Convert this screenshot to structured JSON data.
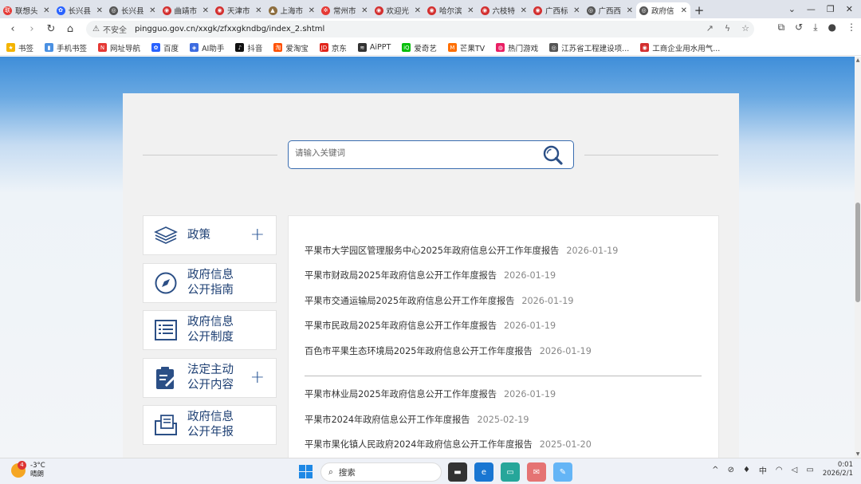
{
  "browser": {
    "tabs": [
      {
        "title": "联想头",
        "color": "#e53935",
        "glyph": "联"
      },
      {
        "title": "长兴县",
        "color": "#2962ff",
        "glyph": "✿"
      },
      {
        "title": "长兴县",
        "color": "#555555",
        "glyph": "◎"
      },
      {
        "title": "曲靖市",
        "color": "#d32f2f",
        "glyph": "◉"
      },
      {
        "title": "天津市",
        "color": "#d32f2f",
        "glyph": "◉"
      },
      {
        "title": "上海市",
        "color": "#8d6e3f",
        "glyph": "▲"
      },
      {
        "title": "常州市",
        "color": "#e53935",
        "glyph": "✲"
      },
      {
        "title": "欢迎光",
        "color": "#d32f2f",
        "glyph": "◉"
      },
      {
        "title": "哈尔滨",
        "color": "#d32f2f",
        "glyph": "◉"
      },
      {
        "title": "六枝特",
        "color": "#d32f2f",
        "glyph": "◉"
      },
      {
        "title": "广西标",
        "color": "#d32f2f",
        "glyph": "◉"
      },
      {
        "title": "广西西",
        "color": "#555555",
        "glyph": "◎"
      },
      {
        "title": "政府信",
        "color": "#555555",
        "glyph": "◎",
        "active": true
      }
    ],
    "new_tab": "+",
    "address": {
      "security": "不安全",
      "url": "pingguo.gov.cn/xxgk/zfxxgkndbg/index_2.shtml"
    },
    "bookmarks": [
      {
        "label": "书签",
        "color": "#f4b400",
        "glyph": "★"
      },
      {
        "label": "手机书签",
        "color": "#4a90e2",
        "glyph": "▮"
      },
      {
        "label": "网址导航",
        "color": "#e53935",
        "glyph": "N"
      },
      {
        "label": "百度",
        "color": "#2962ff",
        "glyph": "✿"
      },
      {
        "label": "AI助手",
        "color": "#3d6be0",
        "glyph": "◈"
      },
      {
        "label": "抖音",
        "color": "#111111",
        "glyph": "♪"
      },
      {
        "label": "爱淘宝",
        "color": "#ff5000",
        "glyph": "淘"
      },
      {
        "label": "京东",
        "color": "#e1251b",
        "glyph": "JD"
      },
      {
        "label": "AiPPT",
        "color": "#333333",
        "glyph": "≋"
      },
      {
        "label": "爱奇艺",
        "color": "#00be06",
        "glyph": "iQ"
      },
      {
        "label": "芒果TV",
        "color": "#ff6f00",
        "glyph": "M"
      },
      {
        "label": "热门游戏",
        "color": "#e91e63",
        "glyph": "◍"
      },
      {
        "label": "江苏省工程建设项...",
        "color": "#555555",
        "glyph": "◎"
      },
      {
        "label": "工商企业用水用气...",
        "color": "#d32f2f",
        "glyph": "◉"
      }
    ]
  },
  "search": {
    "placeholder": "请输入关键词"
  },
  "sidebar": [
    {
      "line1": "政策",
      "line2": "",
      "plus": "+",
      "icon": "layers-icon"
    },
    {
      "line1": "政府信息",
      "line2": "公开指南",
      "plus": "",
      "icon": "compass-icon"
    },
    {
      "line1": "政府信息",
      "line2": "公开制度",
      "plus": "",
      "icon": "list-document-icon"
    },
    {
      "line1": "法定主动",
      "line2": "公开内容",
      "plus": "+",
      "icon": "clipboard-edit-icon"
    },
    {
      "line1": "政府信息",
      "line2": "公开年报",
      "plus": "",
      "icon": "folder-document-icon"
    }
  ],
  "reports": [
    {
      "title": "平果市大学园区管理服务中心2025年政府信息公开工作年度报告",
      "date": "2026-01-19"
    },
    {
      "title": "平果市财政局2025年政府信息公开工作年度报告",
      "date": "2026-01-19"
    },
    {
      "title": "平果市交通运输局2025年政府信息公开工作年度报告",
      "date": "2026-01-19"
    },
    {
      "title": "平果市民政局2025年政府信息公开工作年度报告",
      "date": "2026-01-19"
    },
    {
      "title": "百色市平果生态环境局2025年政府信息公开工作年度报告",
      "date": "2026-01-19"
    },
    {
      "title": "平果市林业局2025年政府信息公开工作年度报告",
      "date": "2026-01-19"
    },
    {
      "title": "平果市2024年政府信息公开工作年度报告",
      "date": "2025-02-19"
    },
    {
      "title": "平果市果化镇人民政府2024年政府信息公开工作年度报告",
      "date": "2025-01-20"
    }
  ],
  "taskbar": {
    "weather_badge": "4",
    "temp": "-3°C",
    "condition": "晴朗",
    "search_label": "搜索",
    "ime": "中",
    "time": "0:01",
    "date": "2026/2/1"
  }
}
